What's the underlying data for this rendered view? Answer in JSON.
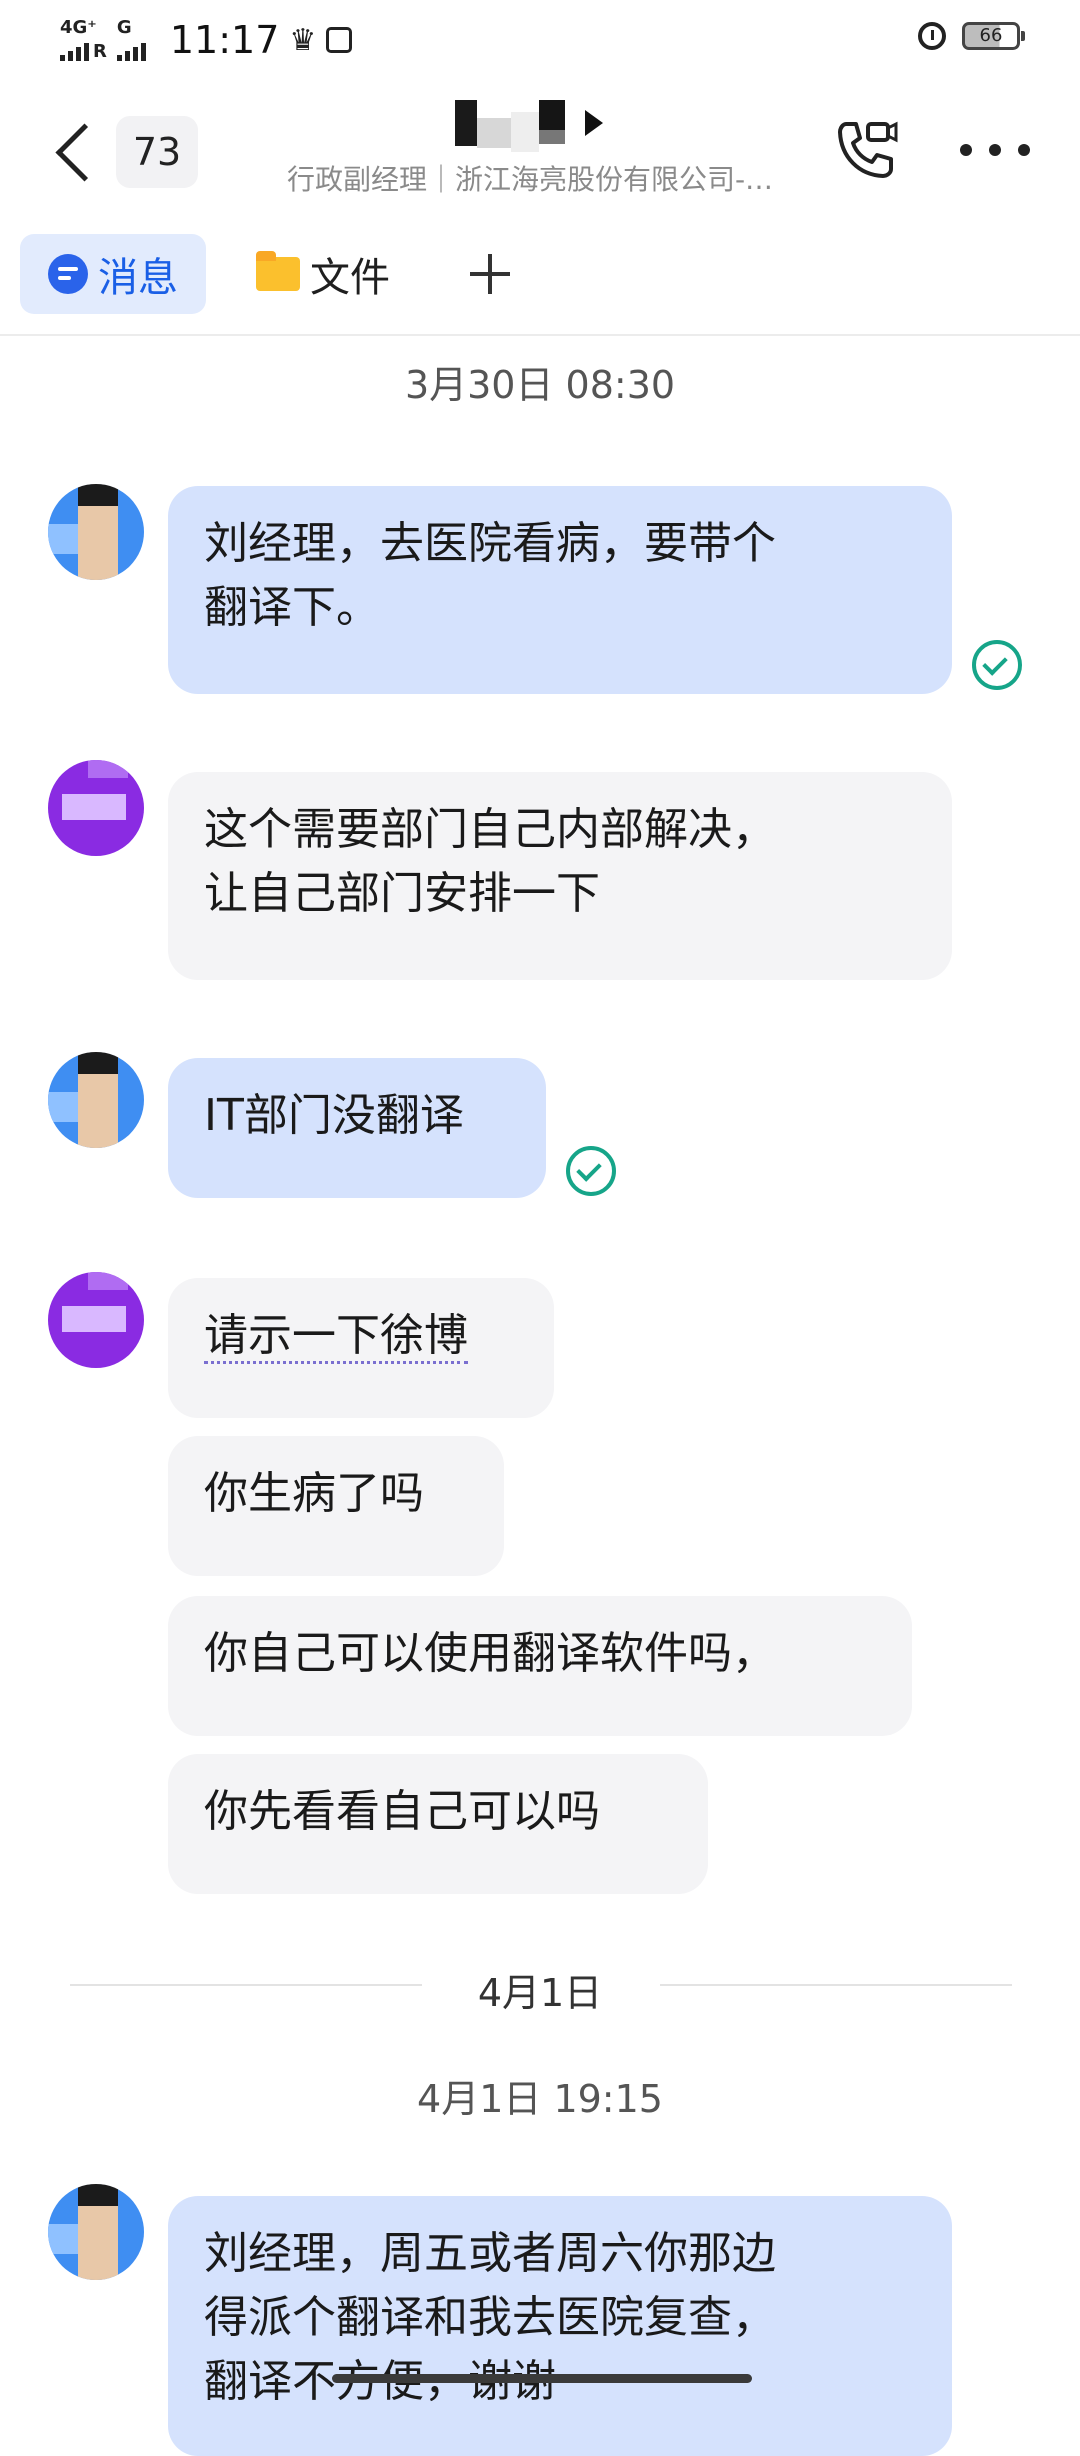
{
  "status_bar": {
    "network": "4G⁺",
    "network2": "R",
    "network3": "G",
    "time": "11:17",
    "battery": "66"
  },
  "header": {
    "unread_count": "73",
    "contact_subtitle": "行政副经理｜浙江海亮股份有限公司-…"
  },
  "tabs": [
    {
      "label": "消息"
    },
    {
      "label": "文件"
    }
  ],
  "chat": {
    "timestamp1": "3月30日 08:30",
    "messages": [
      {
        "sender": "me",
        "text": "刘经理，去医院看病，要带个\n翻译下。"
      },
      {
        "sender": "other",
        "text": "这个需要部门自己内部解决，\n让自己部门安排一下"
      },
      {
        "sender": "me",
        "text": "IT部门没翻译"
      },
      {
        "sender": "other",
        "text": "请示一下徐博"
      },
      {
        "sender": "other",
        "text": "你生病了吗"
      },
      {
        "sender": "other",
        "text": "你自己可以使用翻译软件吗，"
      },
      {
        "sender": "other",
        "text": "你先看看自己可以吗"
      }
    ],
    "date_divider": "4月1日",
    "timestamp2": "4月1日 19:15",
    "last_message": {
      "sender": "me",
      "text": "刘经理，周五或者周六你那边\n得派个翻译和我去医院复查，\n翻译不方便，谢谢"
    }
  }
}
